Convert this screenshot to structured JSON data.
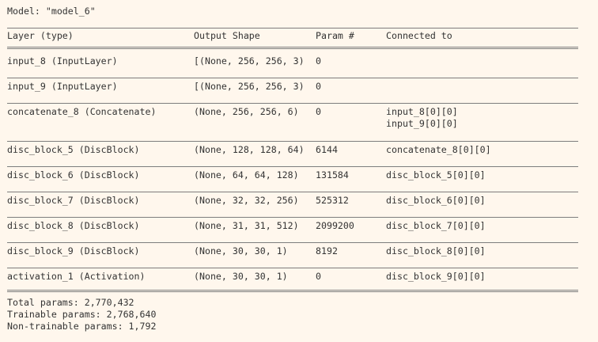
{
  "model_line": "Model: \"model_6\"",
  "headers": {
    "layer": "Layer (type)",
    "shape": "Output Shape",
    "param": "Param #",
    "connected": "Connected to"
  },
  "rows": [
    {
      "layer": "input_8 (InputLayer)",
      "shape": "[(None, 256, 256, 3)",
      "param": "0",
      "connected": []
    },
    {
      "layer": "input_9 (InputLayer)",
      "shape": "[(None, 256, 256, 3)",
      "param": "0",
      "connected": []
    },
    {
      "layer": "concatenate_8 (Concatenate)",
      "shape": "(None, 256, 256, 6)",
      "param": "0",
      "connected": [
        "input_8[0][0]",
        "input_9[0][0]"
      ]
    },
    {
      "layer": "disc_block_5 (DiscBlock)",
      "shape": "(None, 128, 128, 64)",
      "param": "6144",
      "connected": [
        "concatenate_8[0][0]"
      ]
    },
    {
      "layer": "disc_block_6 (DiscBlock)",
      "shape": "(None, 64, 64, 128)",
      "param": "131584",
      "connected": [
        "disc_block_5[0][0]"
      ]
    },
    {
      "layer": "disc_block_7 (DiscBlock)",
      "shape": "(None, 32, 32, 256)",
      "param": "525312",
      "connected": [
        "disc_block_6[0][0]"
      ]
    },
    {
      "layer": "disc_block_8 (DiscBlock)",
      "shape": "(None, 31, 31, 512)",
      "param": "2099200",
      "connected": [
        "disc_block_7[0][0]"
      ]
    },
    {
      "layer": "disc_block_9 (DiscBlock)",
      "shape": "(None, 30, 30, 1)",
      "param": "8192",
      "connected": [
        "disc_block_8[0][0]"
      ]
    },
    {
      "layer": "activation_1 (Activation)",
      "shape": "(None, 30, 30, 1)",
      "param": "0",
      "connected": [
        "disc_block_9[0][0]"
      ]
    }
  ],
  "totals": {
    "total": "Total params: 2,770,432",
    "trainable": "Trainable params: 2,768,640",
    "non_trainable": "Non-trainable params: 1,792"
  }
}
